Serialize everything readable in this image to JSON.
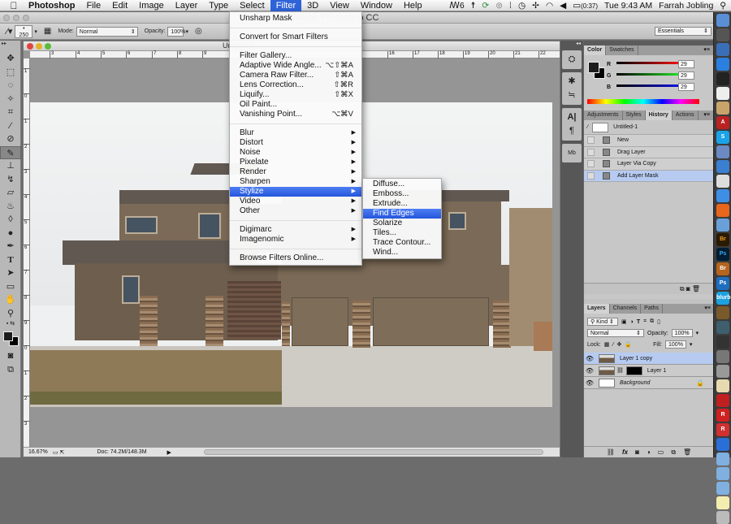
{
  "menubar": {
    "apple_icon": "",
    "items": [
      "Photoshop",
      "File",
      "Edit",
      "Image",
      "Layer",
      "Type",
      "Select",
      "Filter",
      "3D",
      "View",
      "Window",
      "Help"
    ],
    "active_item": "Filter",
    "status": {
      "ai_badge": "6",
      "battery": "(0:37)",
      "clock": "Tue 9:43 AM",
      "user": "Farrah Jobling"
    }
  },
  "app": {
    "title": "Adobe Photoshop CC",
    "workspace": "Essentials"
  },
  "options_bar": {
    "brush_size": "250",
    "mode_label": "Mode:",
    "mode_value": "Normal",
    "opacity_label": "Opacity:",
    "opacity_value": "100%"
  },
  "document": {
    "title": "Untitled-1",
    "ruler_h": [
      "3",
      "4",
      "5",
      "6",
      "7",
      "8",
      "9",
      "16",
      "17",
      "18",
      "19",
      "20",
      "21",
      "22"
    ],
    "ruler_v": [
      "1",
      "0",
      "1",
      "2",
      "3",
      "4",
      "5",
      "6",
      "7",
      "8",
      "9",
      "0",
      "1",
      "2",
      "3"
    ],
    "zoom": "16.67%",
    "doc_size": "Doc: 74.2M/148.3M"
  },
  "filter_menu": {
    "items": [
      {
        "label": "Unsharp Mask"
      },
      {
        "sep": true
      },
      {
        "label": "Convert for Smart Filters"
      },
      {
        "sep": true
      },
      {
        "label": "Filter Gallery..."
      },
      {
        "label": "Adaptive Wide Angle...",
        "shortcut": "⌥⇧⌘A"
      },
      {
        "label": "Camera Raw Filter...",
        "shortcut": "⇧⌘A"
      },
      {
        "label": "Lens Correction...",
        "shortcut": "⇧⌘R"
      },
      {
        "label": "Liquify...",
        "shortcut": "⇧⌘X"
      },
      {
        "label": "Oil Paint..."
      },
      {
        "label": "Vanishing Point...",
        "shortcut": "⌥⌘V"
      },
      {
        "sep": true
      },
      {
        "label": "Blur",
        "submenu": true
      },
      {
        "label": "Distort",
        "submenu": true
      },
      {
        "label": "Noise",
        "submenu": true
      },
      {
        "label": "Pixelate",
        "submenu": true
      },
      {
        "label": "Render",
        "submenu": true
      },
      {
        "label": "Sharpen",
        "submenu": true
      },
      {
        "label": "Stylize",
        "submenu": true,
        "highlighted": true
      },
      {
        "label": "Video",
        "submenu": true
      },
      {
        "label": "Other",
        "submenu": true
      },
      {
        "sep": true
      },
      {
        "label": "Digimarc",
        "submenu": true
      },
      {
        "label": "Imagenomic",
        "submenu": true
      },
      {
        "sep": true
      },
      {
        "label": "Browse Filters Online..."
      }
    ]
  },
  "stylize_menu": {
    "items": [
      {
        "label": "Diffuse..."
      },
      {
        "label": "Emboss..."
      },
      {
        "label": "Extrude..."
      },
      {
        "label": "Find Edges",
        "highlighted": true
      },
      {
        "label": "Solarize"
      },
      {
        "label": "Tiles..."
      },
      {
        "label": "Trace Contour..."
      },
      {
        "label": "Wind..."
      }
    ]
  },
  "color_panel": {
    "tabs": [
      "Color",
      "Swatches"
    ],
    "active_tab": "Color",
    "r": "29",
    "g": "29",
    "b": "29",
    "r_label": "R",
    "g_label": "G",
    "b_label": "B"
  },
  "history_panel": {
    "tabs": [
      "Adjustments",
      "Styles",
      "History",
      "Actions"
    ],
    "active_tab": "History",
    "snapshot": "Untitled-1",
    "states": [
      {
        "label": "New"
      },
      {
        "label": "Drag Layer"
      },
      {
        "label": "Layer Via Copy"
      },
      {
        "label": "Add Layer Mask",
        "selected": true
      }
    ]
  },
  "layers_panel": {
    "tabs": [
      "Layers",
      "Channels",
      "Paths"
    ],
    "active_tab": "Layers",
    "filter_kind": "Kind",
    "blend_mode": "Normal",
    "opacity_label": "Opacity:",
    "opacity": "100%",
    "lock_label": "Lock:",
    "fill_label": "Fill:",
    "fill": "100%",
    "layers": [
      {
        "name": "Layer 1 copy",
        "selected": true,
        "has_mask": false,
        "locked": false
      },
      {
        "name": "Layer 1",
        "selected": false,
        "has_mask": true,
        "locked": false
      },
      {
        "name": "Background",
        "selected": false,
        "has_mask": false,
        "locked": true
      }
    ]
  },
  "tools": [
    "move",
    "marquee",
    "lasso",
    "quick-select",
    "crop",
    "eyedropper",
    "healing",
    "brush",
    "clone-stamp",
    "history-brush",
    "eraser",
    "paint-bucket",
    "blur",
    "dodge",
    "pen",
    "type",
    "path-select",
    "rectangle",
    "hand",
    "zoom"
  ],
  "active_tool": "brush",
  "dock_icons": [
    "finder",
    "launchpad",
    "mission-control",
    "app-store",
    "dashboard",
    "calendar",
    "contacts",
    "acrobat",
    "skype",
    "preview",
    "itunes",
    "mail",
    "safari",
    "firefox",
    "iphoto",
    "bridge",
    "photoshop",
    "bridge-old",
    "photoshop-old",
    "blurb",
    "image-capture",
    "time-machine",
    "facetime",
    "photo-booth",
    "preview2",
    "folder",
    "flash",
    "roblox",
    "roblox-studio",
    "mugshot",
    "folder-documents",
    "folder-downloads",
    "folder-apps",
    "file",
    "trash"
  ]
}
